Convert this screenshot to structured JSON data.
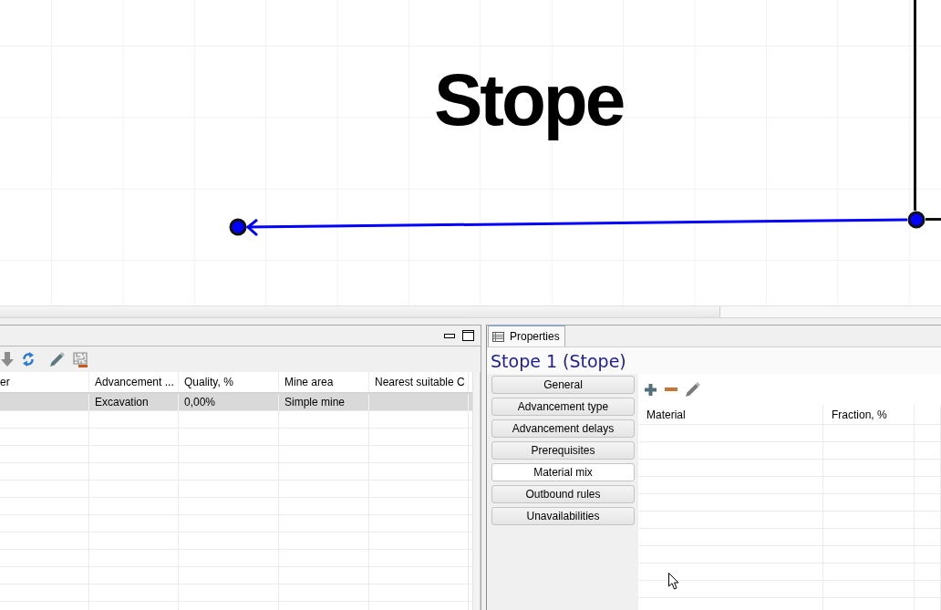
{
  "canvas": {
    "title": "Stope"
  },
  "results_panel": {
    "columns": [
      "er",
      "Advancement ...",
      "Quality, %",
      "Mine area",
      "Nearest suitable C"
    ],
    "rows": [
      {
        "selected": true,
        "cells": [
          null,
          "Excavation",
          "0,00%",
          "Simple mine",
          null
        ]
      }
    ]
  },
  "properties_panel": {
    "tab": "Properties",
    "heading": "Stope 1 (Stope)",
    "sections": [
      {
        "label": "General",
        "selected": false
      },
      {
        "label": "Advancement type",
        "selected": false
      },
      {
        "label": "Advancement delays",
        "selected": false
      },
      {
        "label": "Prerequisites",
        "selected": false
      },
      {
        "label": "Material mix",
        "selected": true
      },
      {
        "label": "Outbound rules",
        "selected": false
      },
      {
        "label": "Unavailabilities",
        "selected": false
      }
    ],
    "material_table": {
      "columns": [
        "Material",
        "Fraction, %"
      ]
    }
  }
}
